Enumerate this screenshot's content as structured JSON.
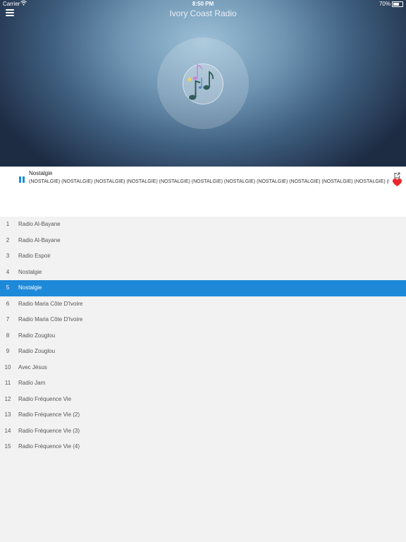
{
  "status_bar": {
    "carrier": "Carrier",
    "time": "8:50 PM",
    "battery": "70%",
    "battery_level": 0.7
  },
  "header": {
    "title": "Ivory Coast Radio",
    "menu_icon": "menu-icon"
  },
  "now_playing": {
    "station": "Nostalgie",
    "metadata": "(NOSTALGIE) (NOSTALGIE) (NOSTALGIE) (NOSTALGIE) (NOSTALGIE) (NOSTALGIE) (NOSTALGIE) (NOSTALGIE) (NOSTALGIE) (NOSTALGIE) (NOSTALGIE) (NOSTALGIE)",
    "state": "playing",
    "favorite": true,
    "accent": "#1e88d9",
    "heart_color": "#e8262b"
  },
  "stations": [
    {
      "num": "1",
      "name": "Radio Al-Bayane"
    },
    {
      "num": "2",
      "name": "Radio Al-Bayane"
    },
    {
      "num": "3",
      "name": "Radio Espoir"
    },
    {
      "num": "4",
      "name": "Nostalgie"
    },
    {
      "num": "5",
      "name": "Nostalgie",
      "selected": true
    },
    {
      "num": "6",
      "name": "Radio Maria Côte D'Ivoire"
    },
    {
      "num": "7",
      "name": "Radio Maria Côte D'Ivoire"
    },
    {
      "num": "8",
      "name": "Radio Zouglou"
    },
    {
      "num": "9",
      "name": "Radio Zouglou"
    },
    {
      "num": "10",
      "name": "Avec Jésus"
    },
    {
      "num": "11",
      "name": "Radio Jam"
    },
    {
      "num": "12",
      "name": "Radio Fréquence Vie"
    },
    {
      "num": "13",
      "name": "Radio Fréquence Vie (2)"
    },
    {
      "num": "14",
      "name": "Radio Fréquence Vie (3)"
    },
    {
      "num": "15",
      "name": "Radio Fréquence Vie (4)"
    }
  ]
}
